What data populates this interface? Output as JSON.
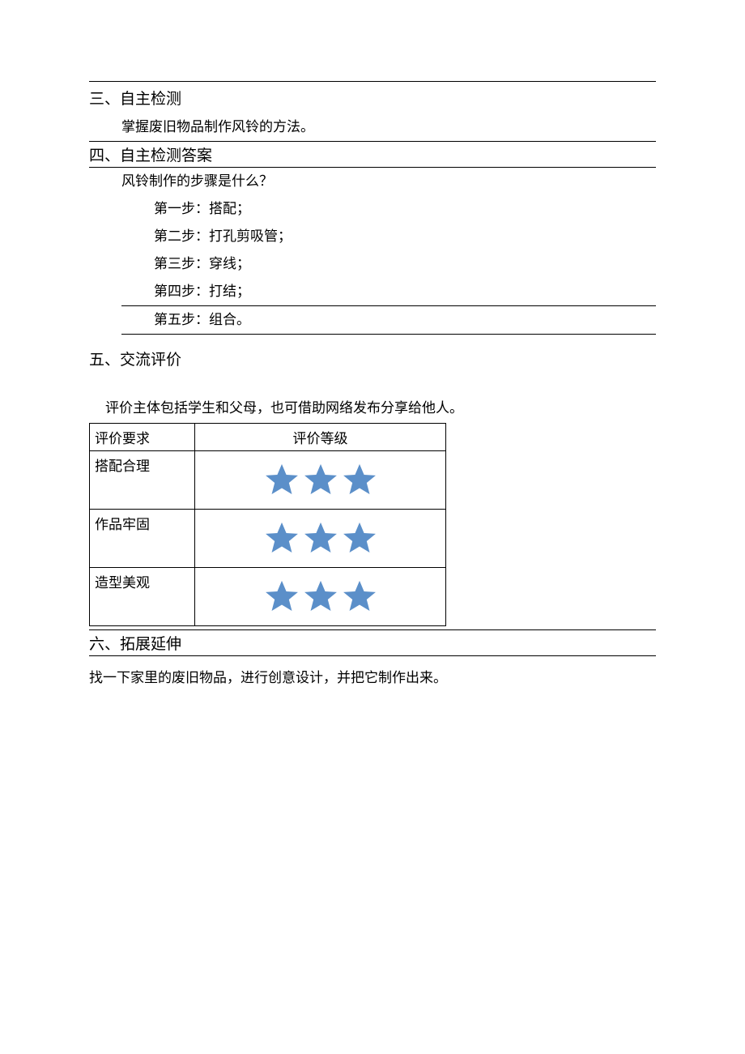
{
  "sections": {
    "s3": {
      "heading": "三、自主检测",
      "body": "掌握废旧物品制作风铃的方法。"
    },
    "s4": {
      "heading": "四、自主检测答案",
      "question": "风铃制作的步骤是什么？",
      "steps": [
        "第一步：搭配；",
        "第二步：打孔剪吸管；",
        "第三步：穿线；",
        "第四步：打结；",
        "第五步：组合。"
      ]
    },
    "s5": {
      "heading": "五、交流评价",
      "note": "评价主体包括学生和父母，也可借助网络发布分享给他人。",
      "table": {
        "header_req": "评价要求",
        "header_level": "评价等级",
        "rows": [
          {
            "req": "搭配合理",
            "stars": 3
          },
          {
            "req": "作品牢固",
            "stars": 3
          },
          {
            "req": "造型美观",
            "stars": 3
          }
        ]
      }
    },
    "s6": {
      "heading": "六、拓展延伸",
      "body": "找一下家里的废旧物品，进行创意设计，并把它制作出来。"
    }
  },
  "colors": {
    "star": "#5b8fc9"
  }
}
